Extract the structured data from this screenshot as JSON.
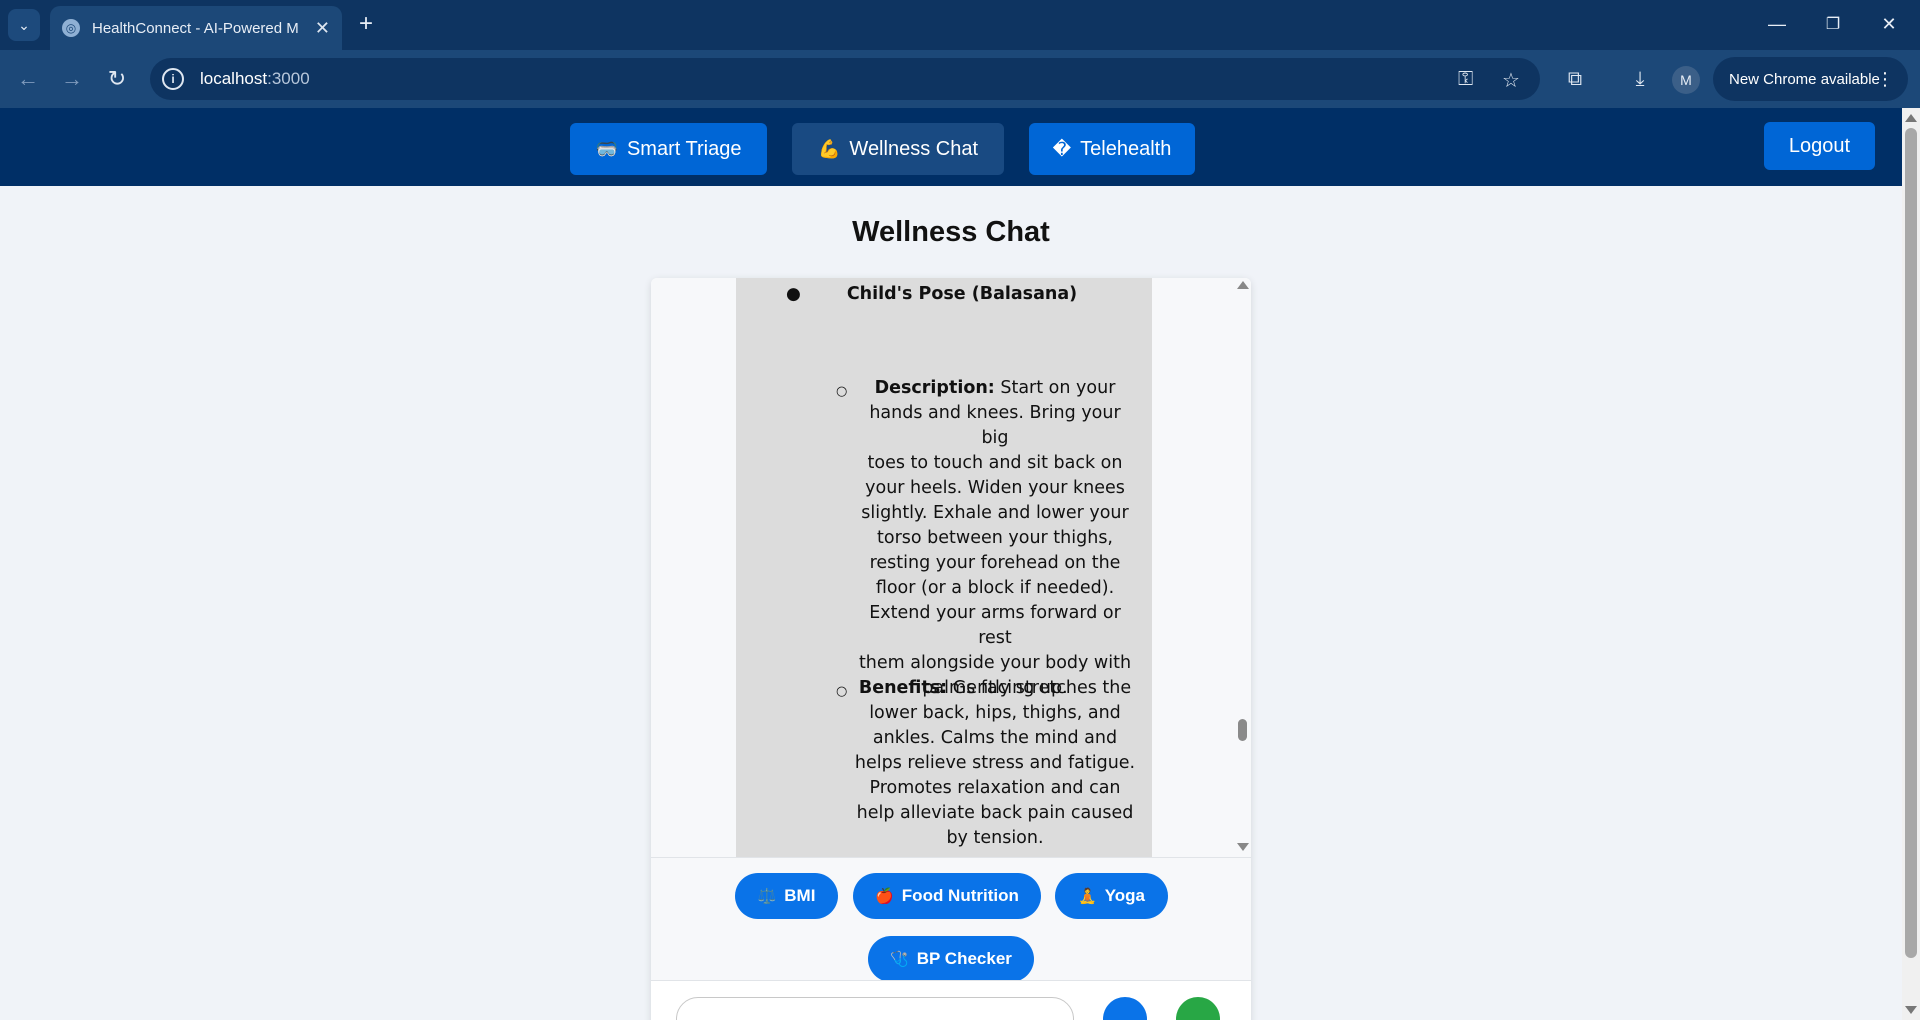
{
  "browser": {
    "tab_title": "HealthConnect - AI-Powered M",
    "url_host": "localhost",
    "url_port": ":3000",
    "profile_initial": "M",
    "update_label": "New Chrome available"
  },
  "app_nav": {
    "items": [
      {
        "emoji": "🥽",
        "label": "Smart Triage",
        "active": true
      },
      {
        "emoji": "💪",
        "label": "Wellness Chat",
        "active": false
      },
      {
        "emoji": "�",
        "label": "Telehealth",
        "active": true
      }
    ],
    "logout_label": "Logout"
  },
  "page": {
    "title": "Wellness Chat"
  },
  "chat": {
    "pose": {
      "title": "Child's Pose (Balasana)",
      "description_label": "Description:",
      "description_lines": [
        " Start on your",
        "hands and knees. Bring your big",
        "toes to touch and sit back on",
        "your heels. Widen your knees",
        "slightly. Exhale and lower your",
        "torso between your thighs,",
        "resting your forehead on the",
        "floor (or a block if needed).",
        "Extend your arms forward or rest",
        "them alongside your body with",
        "palms facing up."
      ],
      "benefits_label": "Benefits:",
      "benefits_lines": [
        " Gently stretches the",
        "lower back, hips, thighs, and",
        "ankles. Calms the mind and",
        "helps relieve stress and fatigue.",
        "Promotes relaxation and can",
        "help alleviate back pain caused",
        "by tension."
      ]
    },
    "quick_actions": [
      {
        "emoji": "⚖️",
        "label": "BMI"
      },
      {
        "emoji": "🍎",
        "label": "Food Nutrition"
      },
      {
        "emoji": "🧘",
        "label": "Yoga"
      },
      {
        "emoji": "🩺",
        "label": "BP Checker"
      }
    ]
  },
  "colors": {
    "browser_frame": "#0e3461",
    "app_nav_bg": "#002f66",
    "accent_blue": "#0a73e8",
    "bubble_bg": "#dcdcdc",
    "page_bg": "#f0f3f8"
  }
}
